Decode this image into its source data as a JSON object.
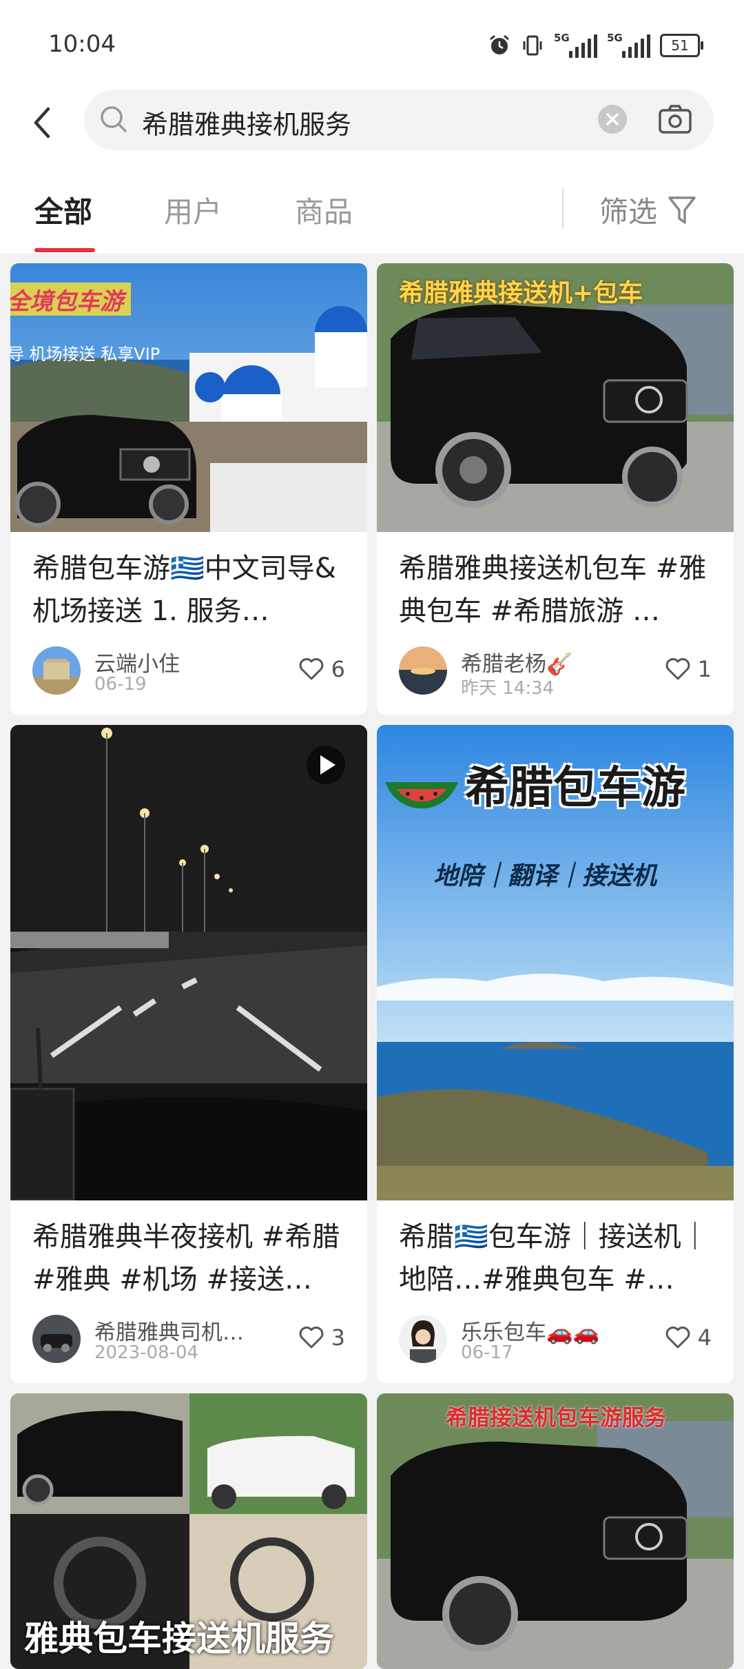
{
  "status": {
    "time": "10:04",
    "battery": "51",
    "sig1": "5G",
    "sig2": "5G"
  },
  "search": {
    "query": "希腊雅典接机服务"
  },
  "tabs": [
    {
      "label": "全部",
      "active": true
    },
    {
      "label": "用户",
      "active": false
    },
    {
      "label": "商品",
      "active": false
    }
  ],
  "filter": {
    "label": "筛选"
  },
  "accent": "#e9303e",
  "cards": [
    {
      "title": "希腊包车游🇬🇷中文司导&机场接送 1. 服务…",
      "author": "云端小住",
      "date": "06-19",
      "likes": "6",
      "image_caption": "全境包车游",
      "image_subcaption": "导 机场接送 私享VIP"
    },
    {
      "title": "希腊雅典接送机包车 #雅典包车 #希腊旅游 …",
      "author": "希腊老杨🎸",
      "date": "昨天 14:34",
      "likes": "1",
      "image_caption": "希腊雅典接送机+包车"
    },
    {
      "title": "希腊雅典半夜接机 #希腊 #雅典 #机场 #接送…",
      "author": "希腊雅典司机…",
      "date": "2023-08-04",
      "likes": "3",
      "video": true
    },
    {
      "title": "希腊🇬🇷包车游｜接送机｜地陪…#雅典包车 #…",
      "author": "乐乐包车🚗🚗",
      "date": "06-17",
      "likes": "4",
      "image_caption": "希腊包车游",
      "image_subcaption": "地陪｜翻译｜接送机"
    },
    {
      "image_caption": "雅典包车接送机服务"
    },
    {
      "image_caption": "希腊接送机包车游服务"
    }
  ]
}
